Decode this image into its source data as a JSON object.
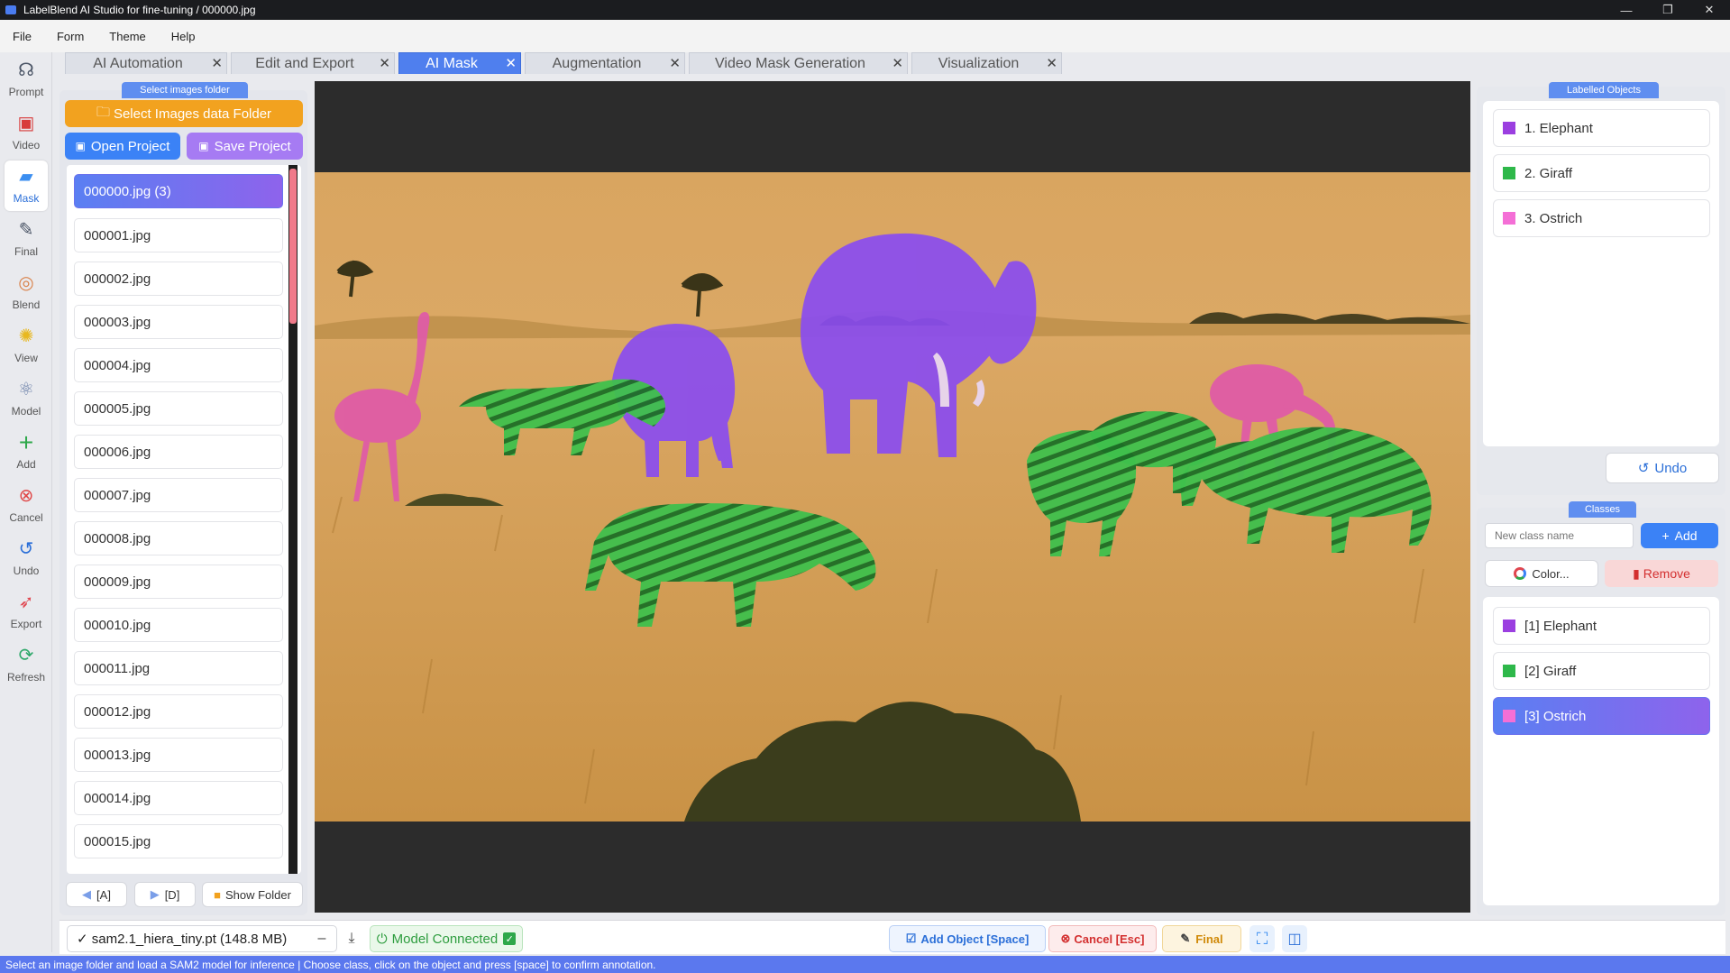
{
  "window": {
    "title": "LabelBlend AI Studio for fine-tuning / 000000.jpg",
    "min": "—",
    "max": "❐",
    "close": "✕"
  },
  "menu": [
    "File",
    "Form",
    "Theme",
    "Help"
  ],
  "tools": [
    {
      "label": "Prompt",
      "icon": "prompt-icon",
      "glyph": "☊"
    },
    {
      "label": "Video",
      "icon": "video-icon",
      "glyph": "▣"
    },
    {
      "label": "Mask",
      "icon": "mask-icon",
      "glyph": "▰"
    },
    {
      "label": "Final",
      "icon": "pen-icon",
      "glyph": "✎"
    },
    {
      "label": "Blend",
      "icon": "blend-icon",
      "glyph": "◎"
    },
    {
      "label": "View",
      "icon": "view-icon",
      "glyph": "✺"
    },
    {
      "label": "Model",
      "icon": "model-icon",
      "glyph": "⚛"
    },
    {
      "label": "Add",
      "icon": "add-icon",
      "glyph": "+"
    },
    {
      "label": "Cancel",
      "icon": "cancel-icon",
      "glyph": "⊗"
    },
    {
      "label": "Undo",
      "icon": "undo-icon",
      "glyph": "↺"
    },
    {
      "label": "Export",
      "icon": "export-icon",
      "glyph": "➶"
    },
    {
      "label": "Refresh",
      "icon": "refresh-icon",
      "glyph": "⟳"
    }
  ],
  "tabs": [
    {
      "label": "AI Automation"
    },
    {
      "label": "Edit and Export"
    },
    {
      "label": "AI Mask"
    },
    {
      "label": "Augmentation"
    },
    {
      "label": "Video Mask Generation"
    },
    {
      "label": "Visualization"
    }
  ],
  "left": {
    "panel_label": "Select images folder",
    "select_folder": "Select Images data Folder",
    "open_project": "Open Project",
    "save_project": "Save Project",
    "files": [
      "000000.jpg    (3)",
      "000001.jpg",
      "000002.jpg",
      "000003.jpg",
      "000004.jpg",
      "000005.jpg",
      "000006.jpg",
      "000007.jpg",
      "000008.jpg",
      "000009.jpg",
      "000010.jpg",
      "000011.jpg",
      "000012.jpg",
      "000013.jpg",
      "000014.jpg",
      "000015.jpg"
    ],
    "prev": "[A]",
    "next": "[D]",
    "show_folder": "Show Folder"
  },
  "objects": {
    "panel_label": "Labelled Objects",
    "items": [
      {
        "label": "1. Elephant",
        "color": "#9b3fe0"
      },
      {
        "label": "2. Giraff",
        "color": "#2eb84a"
      },
      {
        "label": "3. Ostrich",
        "color": "#f46fd6"
      }
    ],
    "undo": "Undo"
  },
  "classes": {
    "panel_label": "Classes",
    "placeholder": "New class name",
    "add": "Add",
    "color": "Color...",
    "remove": "Remove",
    "items": [
      {
        "label": "[1]  Elephant",
        "color": "#9b3fe0"
      },
      {
        "label": "[2]  Giraff",
        "color": "#2eb84a"
      },
      {
        "label": "[3]  Ostrich",
        "color": "#f46fd6"
      }
    ]
  },
  "bottom": {
    "model": "✓  sam2.1_hiera_tiny.pt   (148.8 MB)",
    "model_status": "Model Connected",
    "add_object": "Add Object [Space]",
    "cancel": "Cancel [Esc]",
    "final": "Final"
  },
  "status": "Select an image folder and load a SAM2 model for inference | Choose class, click on the object and press [space] to confirm annotation."
}
